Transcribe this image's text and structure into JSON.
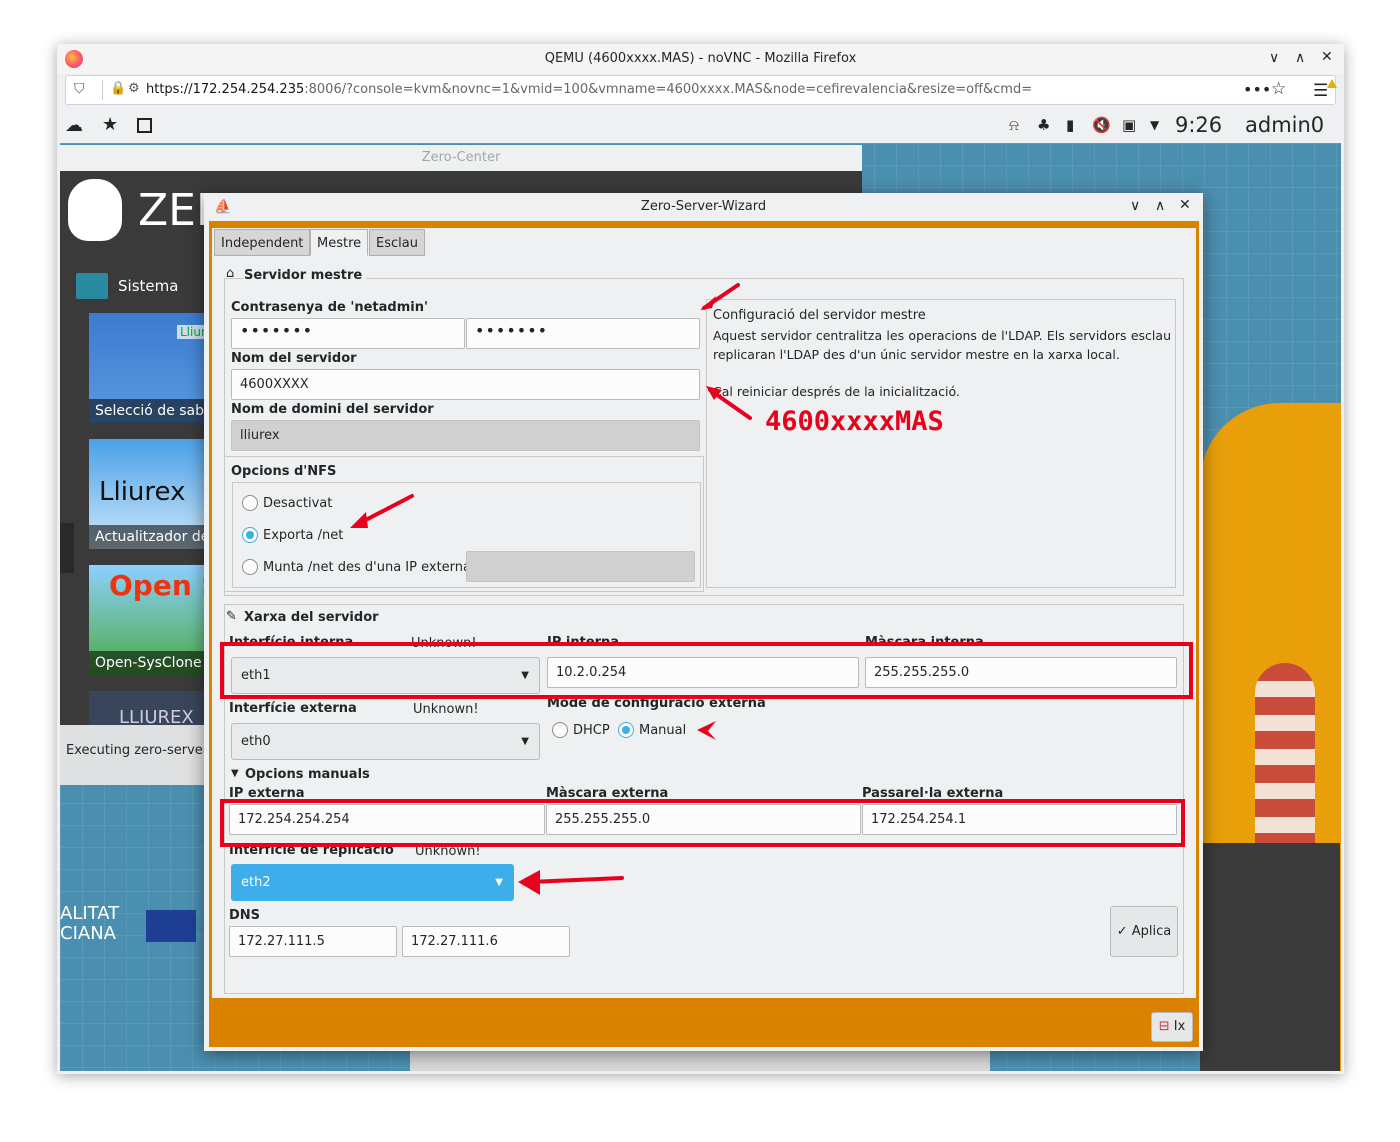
{
  "firefox": {
    "title": "QEMU (4600xxxx.MAS) - noVNC - Mozilla Firefox",
    "url_host": "https://172.254.254.235",
    "url_rest": ":8006/?console=kvm&novnc=1&vmid=100&vmname=4600xxxx.MAS&node=cefirevalencia&resize=off&cmd=",
    "win_min": "∨",
    "win_max": "∧",
    "win_close": "✕"
  },
  "panel": {
    "clock": "9:26",
    "user": "admin0"
  },
  "zero_center": {
    "title": "Zero-Center",
    "logo_text": "ZER",
    "section": "Sistema",
    "tiles": [
      "Selecció de sabo",
      "Actualitzador de",
      "Open-SysClone",
      "LLIUREX"
    ],
    "tile_art": [
      "LliureX",
      "Lliurex",
      "Open Sy"
    ],
    "status": "Executing zero-server-",
    "footer_left": "ALITAT\nCIANA"
  },
  "wizard": {
    "title": "Zero-Server-Wizard",
    "tabs": [
      "Independent",
      "Mestre",
      "Esclau"
    ],
    "active_tab": "Mestre",
    "master": {
      "section_title": "Servidor mestre",
      "password_label": "Contrasenya de 'netadmin'",
      "password1": "•••••••",
      "password2": "•••••••",
      "server_name_label": "Nom del servidor",
      "server_name": "4600XXXX",
      "domain_label": "Nom de domini del servidor",
      "domain": "lliurex",
      "nfs_label": "Opcions d'NFS",
      "nfs_options": [
        "Desactivat",
        "Exporta /net",
        "Munta /net des d'una IP externa"
      ],
      "nfs_selected": "Exporta /net",
      "info_title": "Configuració del servidor mestre",
      "info_body": "Aquest servidor centralitza les operacions de l'LDAP. Els servidors esclau replicaran l'LDAP des d'un únic servidor mestre en la xarxa local.",
      "info_note": "Cal reiniciar després de la inicialització."
    },
    "network": {
      "section_title": "Xarxa del servidor",
      "internal_if_label": "Interfície interna",
      "internal_if_status": "Unknown!",
      "internal_if": "eth1",
      "internal_ip_label": "IP interna",
      "internal_ip": "10.2.0.254",
      "internal_mask_label": "Màscara interna",
      "internal_mask": "255.255.255.0",
      "external_if_label": "Interfície externa",
      "external_if_status": "Unknown!",
      "external_if": "eth0",
      "ext_mode_label": "Mode de configuració externa",
      "ext_modes": [
        "DHCP",
        "Manual"
      ],
      "ext_mode_selected": "Manual",
      "manual_toggle": "Opcions manuals",
      "external_ip_label": "IP externa",
      "external_ip": "172.254.254.254",
      "external_mask_label": "Màscara externa",
      "external_mask": "255.255.255.0",
      "gateway_label": "Passarel·la externa",
      "gateway": "172.254.254.1",
      "replication_if_label": "Interfície de replicació",
      "replication_if_status": "Unknown!",
      "replication_if": "eth2",
      "dns_label": "DNS",
      "dns1": "172.27.111.5",
      "dns2": "172.27.111.6"
    },
    "apply_button": "Aplica",
    "exit_button": "Ix"
  },
  "annotation": {
    "text": "4600xxxxMAS",
    "color": "#e8001c"
  }
}
